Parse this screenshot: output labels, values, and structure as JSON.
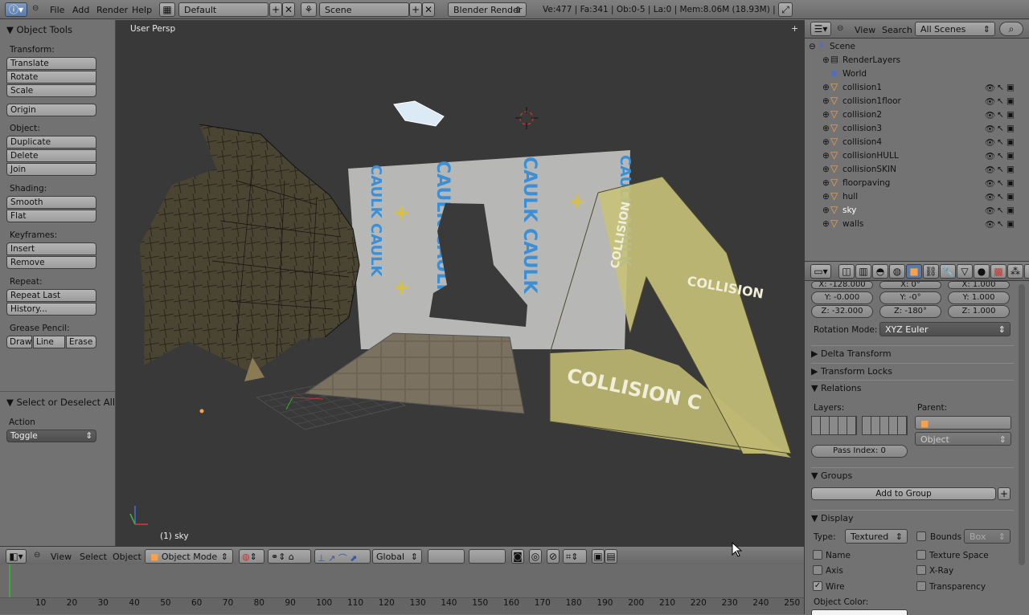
{
  "topbar": {
    "menus": [
      "File",
      "Add",
      "Render",
      "Help"
    ],
    "screen_layout": "Default",
    "scene": "Scene",
    "render_engine": "Blender Render",
    "stats": "Ve:477 | Fa:341 | Ob:0-5 | La:0 | Mem:8.06M (18.93M) | sky"
  },
  "toolshelf": {
    "title": "Object Tools",
    "transform_label": "Transform:",
    "translate": "Translate",
    "rotate": "Rotate",
    "scale": "Scale",
    "origin": "Origin",
    "object_label": "Object:",
    "duplicate": "Duplicate",
    "delete": "Delete",
    "join": "Join",
    "shading_label": "Shading:",
    "smooth": "Smooth",
    "flat": "Flat",
    "keyframes_label": "Keyframes:",
    "insert": "Insert",
    "remove": "Remove",
    "repeat_label": "Repeat:",
    "repeat_last": "Repeat Last",
    "history": "History...",
    "grease_label": "Grease Pencil:",
    "draw": "Draw",
    "line": "Line",
    "erase": "Erase",
    "operator_title": "Select or Deselect All",
    "action_label": "Action",
    "action_value": "Toggle"
  },
  "viewport": {
    "view_name": "User Persp",
    "active_object": "(1) sky",
    "textures": {
      "caulk_text": "CAULK CAULK",
      "collision_text": "COLLISION C",
      "collision_small": "COLLISION",
      "collision_vert": "COLLISION"
    }
  },
  "viewheader": {
    "view": "View",
    "select": "Select",
    "object": "Object",
    "mode": "Object Mode",
    "orientation": "Global"
  },
  "timeline": {
    "ticks": [
      "10",
      "20",
      "30",
      "40",
      "50",
      "60",
      "70",
      "80",
      "90",
      "100",
      "110",
      "120",
      "130",
      "140",
      "150",
      "160",
      "170",
      "180",
      "190",
      "200",
      "210",
      "220",
      "230",
      "240",
      "250"
    ]
  },
  "outliner": {
    "view": "View",
    "search": "Search",
    "filter": "All Scenes",
    "scene": "Scene",
    "render_layers": "RenderLayers",
    "world": "World",
    "objects": [
      "collision1",
      "collision1floor",
      "collision2",
      "collision3",
      "collision4",
      "collisionHULL",
      "collisionSKIN",
      "floorpaving",
      "hull",
      "sky",
      "walls"
    ]
  },
  "properties": {
    "loc_x": "X: -128.000",
    "loc_y": "Y: -0.000",
    "loc_z": "Z: -32.000",
    "rot_x": "X: 0°",
    "rot_y": "Y: -0°",
    "rot_z": "Z: -180°",
    "scale_x": "X: 1.000",
    "scale_y": "Y: 1.000",
    "scale_z": "Z: 1.000",
    "rotation_mode_label": "Rotation Mode:",
    "rotation_mode": "XYZ Euler",
    "delta_transform": "Delta Transform",
    "transform_locks": "Transform Locks",
    "relations": "Relations",
    "layers_label": "Layers:",
    "parent_label": "Parent:",
    "parent_type": "Object",
    "pass_index": "Pass Index: 0",
    "groups": "Groups",
    "add_to_group": "Add to Group",
    "display": "Display",
    "type_label": "Type:",
    "type_value": "Textured",
    "bounds": "Bounds",
    "bounds_type": "Box",
    "name": "Name",
    "texture_space": "Texture Space",
    "axis": "Axis",
    "xray": "X-Ray",
    "wire": "Wire",
    "transparency": "Transparency",
    "object_color": "Object Color:"
  },
  "colors": {
    "viewport_bg": "#393939",
    "panel_bg": "#727272",
    "active_orange": "#f7a14a",
    "wall_grey": "#b8b8b8",
    "caulk_blue": "#3b8fd6",
    "collision_yellow": "#c9c27a"
  }
}
